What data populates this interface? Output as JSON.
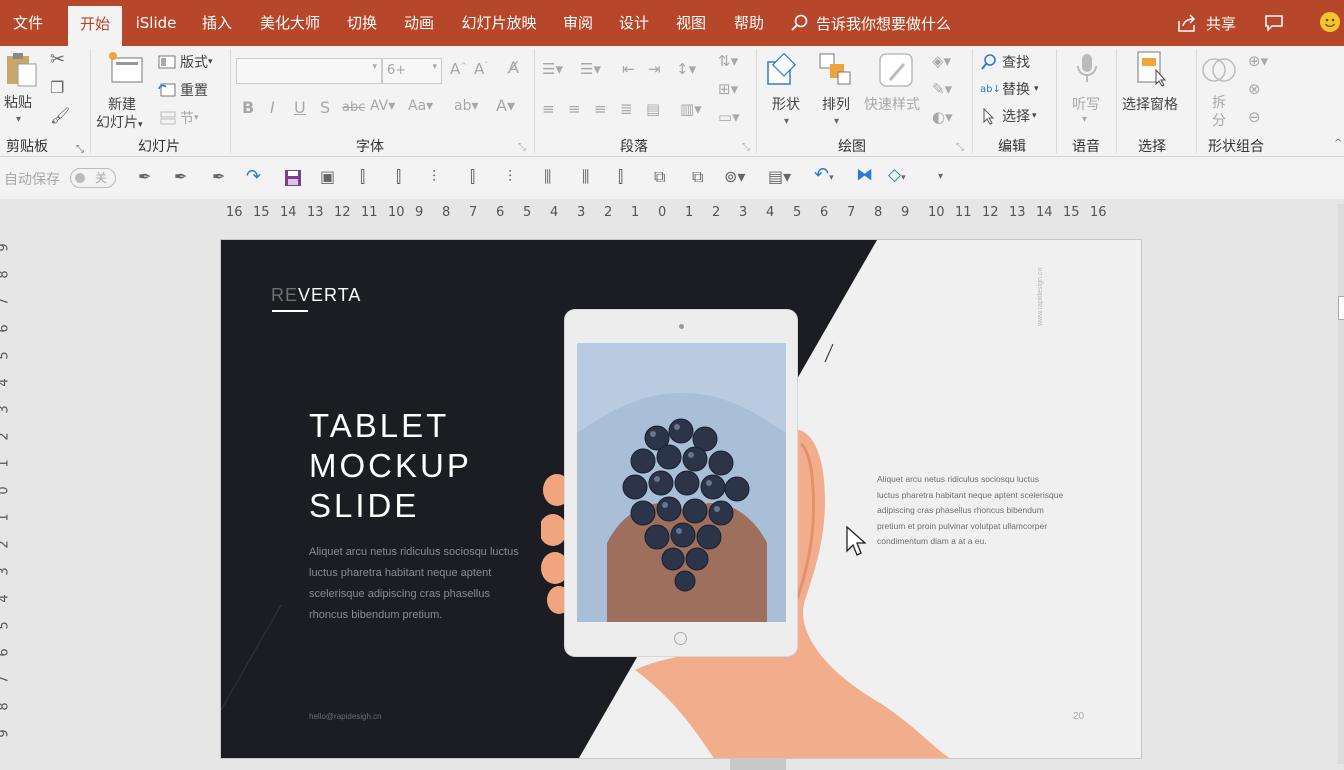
{
  "menu": {
    "file": "文件",
    "home": "开始",
    "islide": "iSlide",
    "insert": "插入",
    "beautify": "美化大师",
    "transitions": "切换",
    "animations": "动画",
    "slideshow": "幻灯片放映",
    "review": "审阅",
    "design": "设计",
    "view": "视图",
    "help": "帮助",
    "tell_me": "告诉我你想要做什么",
    "share": "共享"
  },
  "ribbon": {
    "clipboard": {
      "paste": "粘贴",
      "group": "剪贴板"
    },
    "slides": {
      "new_slide_1": "新建",
      "new_slide_2": "幻灯片",
      "layout": "版式",
      "reset": "重置",
      "section": "节",
      "group": "幻灯片"
    },
    "font": {
      "font_name": "",
      "font_size": "6+",
      "group": "字体"
    },
    "paragraph": {
      "group": "段落"
    },
    "drawing": {
      "shapes": "形状",
      "arrange": "排列",
      "quick_styles": "快速样式",
      "group": "绘图"
    },
    "editing": {
      "find": "查找",
      "replace": "替换",
      "select": "选择",
      "group": "编辑"
    },
    "voice": {
      "dictate": "听写",
      "group": "语音"
    },
    "selection": {
      "pane": "选择窗格",
      "group": "选择"
    },
    "shape_combine": {
      "split_1": "拆",
      "split_2": "分",
      "group": "形状组合"
    }
  },
  "qat": {
    "autosave": "自动保存",
    "autosave_state": "关"
  },
  "ruler": {
    "horizontal": [
      "16",
      "15",
      "14",
      "13",
      "12",
      "11",
      "10",
      "9",
      "8",
      "7",
      "6",
      "5",
      "4",
      "3",
      "2",
      "1",
      "0",
      "1",
      "2",
      "3",
      "4",
      "5",
      "6",
      "7",
      "8",
      "9",
      "10",
      "11",
      "12",
      "13",
      "14",
      "15",
      "16"
    ],
    "vertical": [
      "9",
      "8",
      "7",
      "6",
      "5",
      "4",
      "3",
      "2",
      "1",
      "0",
      "1",
      "2",
      "3",
      "4",
      "5",
      "6",
      "7",
      "8",
      "9"
    ]
  },
  "slide": {
    "brand_re": "RE",
    "brand_verta": "VERTA",
    "title_1": "TABLET",
    "title_2": "MOCKUP",
    "title_3": "SLIDE",
    "body_lines": [
      "Aliquet arcu netus ridiculus sociosqu luctus",
      "luctus pharetra habitant neque aptent",
      "scelerisque adipiscing cras phasellus",
      "rhoncus bibendum pretium."
    ],
    "right_lines": [
      "Aliquet arcu netus ridiculus sociosqu luctus",
      "luctus pharetra habitant neque aptent scelerisque",
      "adipiscing cras phasellus rhoncus bibendum",
      "pretium et proin pulvinar volutpat ullamcorper",
      "condimentum diam a at a eu."
    ],
    "website": "www.rapidesign.cn",
    "email": "hello@rapidesigh.cn",
    "page_number": "20"
  },
  "colors": {
    "accent": "#b7472a",
    "slide_dark": "#1c1d22",
    "slide_light": "#f0f0f0"
  }
}
